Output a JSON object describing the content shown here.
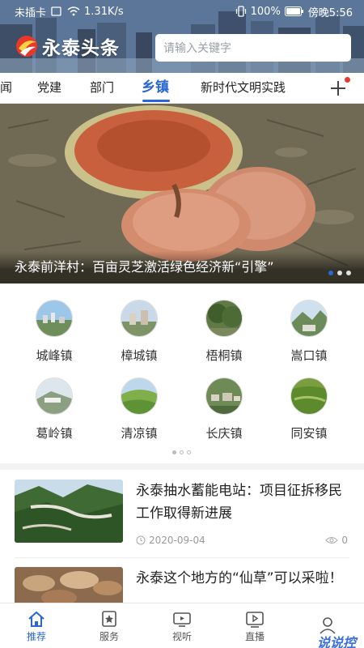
{
  "status_bar": {
    "carrier": "未插卡",
    "speed": "1.31K/s",
    "battery": "100%",
    "time": "傍晚5:56"
  },
  "header": {
    "logo_text": "永泰头条",
    "search_placeholder": "请输入关键字"
  },
  "tabs": [
    "闻",
    "党建",
    "部门",
    "乡镇",
    "新时代文明实践"
  ],
  "active_tab": "乡镇",
  "banner": {
    "caption": "永泰前洋村：百亩灵芝激活绿色经济新“引擎”"
  },
  "towns": [
    "城峰镇",
    "樟城镇",
    "梧桐镇",
    "嵩口镇",
    "葛岭镇",
    "清凉镇",
    "长庆镇",
    "同安镇"
  ],
  "news": [
    {
      "title": "永泰抽水蓄能电站：项目征拆移民工作取得新进展",
      "date": "2020-09-04",
      "views": "0"
    },
    {
      "title": "永泰这个地方的“仙草”可以采啦！"
    }
  ],
  "bottom_nav": [
    "推荐",
    "服务",
    "视听",
    "直播",
    ""
  ],
  "watermark": "说说控",
  "colors": {
    "accent": "#2a66d4",
    "notify_dot": "#e53935"
  }
}
